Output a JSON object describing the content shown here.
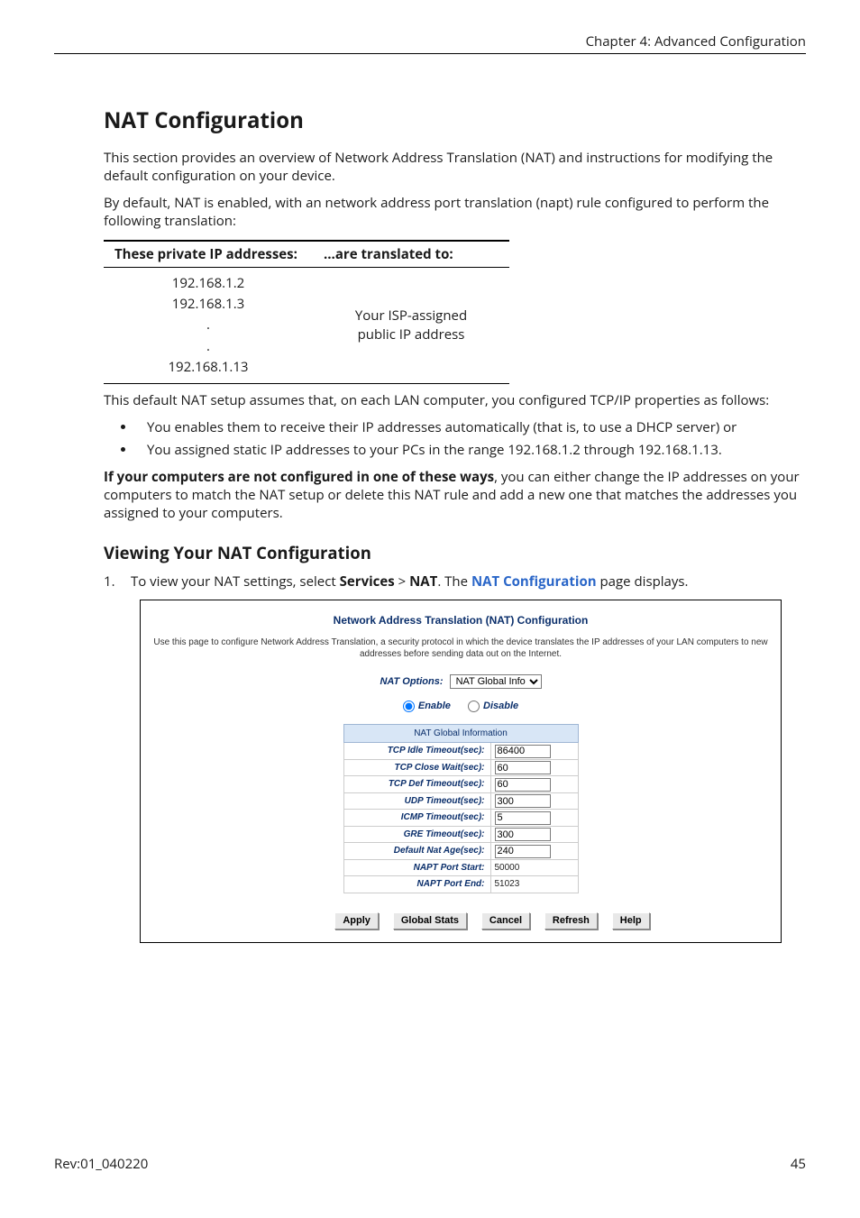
{
  "header": {
    "chapter": "Chapter 4: Advanced Configuration"
  },
  "section": {
    "title": "NAT Configuration",
    "intro1": "This section provides an overview of Network Address Translation (NAT) and instructions for modifying the default configuration on your device.",
    "intro2": "By default, NAT is enabled, with an network address port translation (napt) rule configured to perform the following translation:"
  },
  "translate_table": {
    "col1": "These private IP addresses:",
    "col2": "…are translated to:",
    "left_ips": [
      "192.168.1.2",
      "192.168.1.3",
      ".",
      ".",
      "192.168.1.13"
    ],
    "right_text_line1": "Your ISP-assigned",
    "right_text_line2": "public IP address"
  },
  "after_table": "This default NAT setup assumes that, on each LAN computer, you configured TCP/IP properties as follows:",
  "bullets": [
    "You enables them to receive their IP addresses automatically (that is, to use a DHCP server) or",
    "You assigned static IP addresses to your PCs in the range 192.168.1.2 through 192.168.1.13."
  ],
  "bold_line_prefix": "If your computers are not configured in one of these ways",
  "bold_line_rest": ", you can either change the IP addresses on your computers to match the NAT setup or delete this NAT rule and add a new one that matches the addresses you assigned to your computers.",
  "subheading": "Viewing Your NAT Configuration",
  "step1": {
    "num": "1.",
    "pre": "To view your NAT settings, select ",
    "services": "Services",
    "gt": " > ",
    "nat": "NAT",
    "mid": ". The ",
    "link": "NAT Configuration",
    "post": " page displays."
  },
  "ui": {
    "title": "Network Address Translation (NAT) Configuration",
    "desc": "Use this page to configure Network Address Translation, a security protocol in which the device translates the IP addresses of your LAN computers to new addresses before sending data out on the Internet.",
    "options_label": "NAT Options:",
    "options_value": "NAT Global Info",
    "enable": "Enable",
    "disable": "Disable",
    "table_header": "NAT Global Information",
    "rows": [
      {
        "k": "TCP Idle Timeout(sec):",
        "v": "86400",
        "editable": true
      },
      {
        "k": "TCP Close Wait(sec):",
        "v": "60",
        "editable": true
      },
      {
        "k": "TCP Def Timeout(sec):",
        "v": "60",
        "editable": true
      },
      {
        "k": "UDP Timeout(sec):",
        "v": "300",
        "editable": true
      },
      {
        "k": "ICMP Timeout(sec):",
        "v": "5",
        "editable": true
      },
      {
        "k": "GRE Timeout(sec):",
        "v": "300",
        "editable": true
      },
      {
        "k": "Default Nat Age(sec):",
        "v": "240",
        "editable": true
      },
      {
        "k": "NAPT Port Start:",
        "v": "50000",
        "editable": false
      },
      {
        "k": "NAPT Port End:",
        "v": "51023",
        "editable": false
      }
    ],
    "buttons": [
      "Apply",
      "Global Stats",
      "Cancel",
      "Refresh",
      "Help"
    ]
  },
  "footer": {
    "left": "Rev:01_040220",
    "right": "45"
  }
}
